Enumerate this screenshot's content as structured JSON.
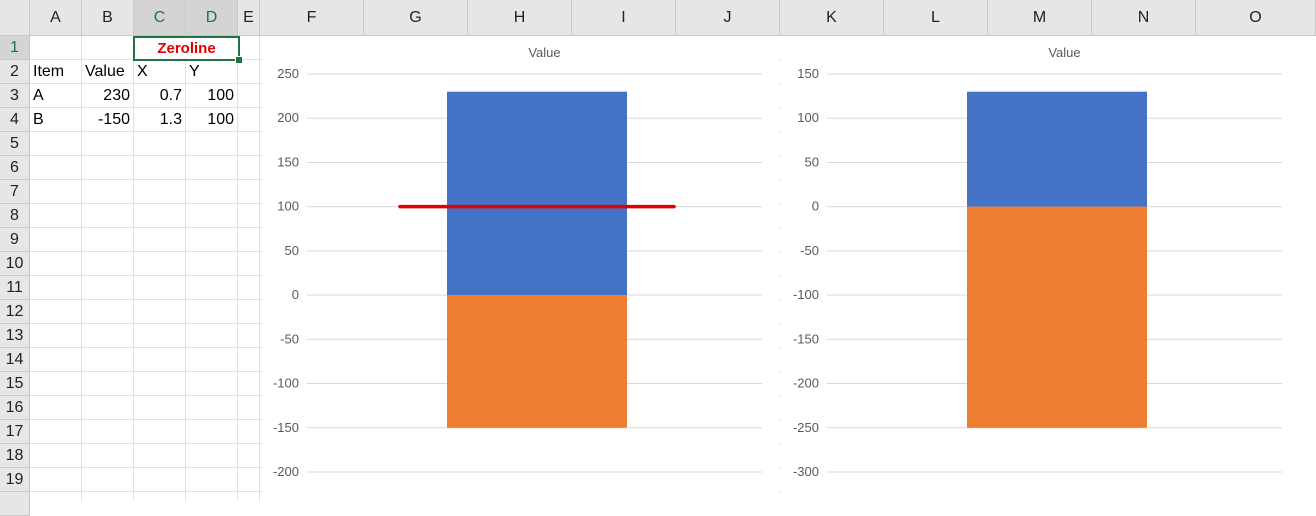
{
  "columns": [
    "A",
    "B",
    "C",
    "D",
    "E",
    "F",
    "G",
    "H",
    "I",
    "J",
    "K",
    "L",
    "M",
    "N",
    "O"
  ],
  "rows": [
    "1",
    "2",
    "3",
    "4",
    "5",
    "6",
    "7",
    "8",
    "9",
    "10",
    "11",
    "12",
    "13",
    "14",
    "15",
    "16",
    "17",
    "18",
    "19"
  ],
  "selected_cell": {
    "text": "Zeroline",
    "color": "#e00000"
  },
  "table": {
    "headers": [
      "Item",
      "Value",
      "X",
      "Y"
    ],
    "rows": [
      {
        "item": "A",
        "value": "230",
        "x": "0.7",
        "y": "100"
      },
      {
        "item": "B",
        "value": "-150",
        "x": "1.3",
        "y": "100"
      }
    ]
  },
  "chart_data": [
    {
      "type": "bar",
      "stacked": true,
      "title": "Value",
      "ylim": [
        -200,
        250
      ],
      "ytick_step": 50,
      "grid": true,
      "legend": "none",
      "series": [
        {
          "values": [
            230
          ],
          "color": "#4472c4"
        },
        {
          "values": [
            -150
          ],
          "color": "#ed7d31"
        }
      ],
      "overlay_line": {
        "x": [
          0.7,
          1.3
        ],
        "y": [
          100,
          100
        ],
        "color": "#e00000"
      }
    },
    {
      "type": "bar",
      "stacked": true,
      "title": "Value",
      "ylim": [
        -300,
        150
      ],
      "ytick_step": 50,
      "grid": true,
      "legend": "none",
      "series": [
        {
          "values": [
            130
          ],
          "color": "#4472c4"
        },
        {
          "values": [
            -250
          ],
          "color": "#ed7d31"
        }
      ]
    }
  ]
}
